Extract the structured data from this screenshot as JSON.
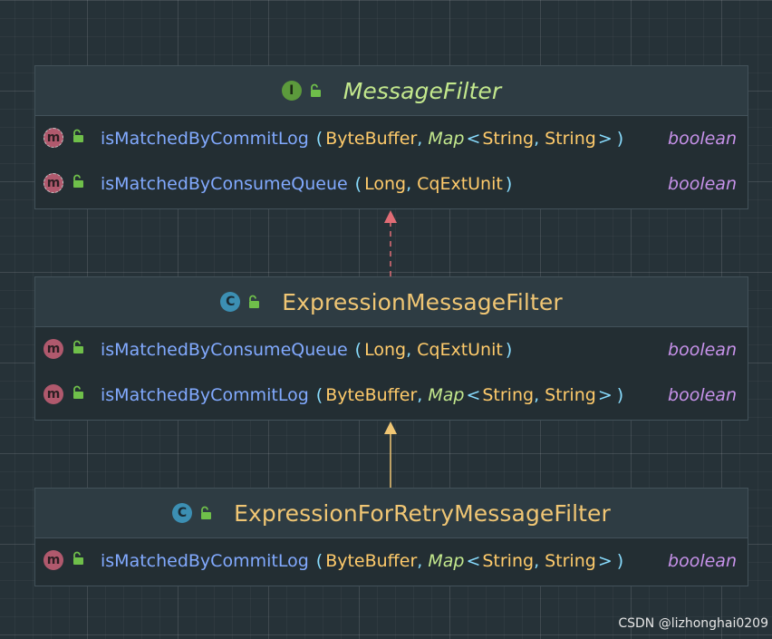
{
  "classes": [
    {
      "kind": "interface",
      "kind_letter": "I",
      "name": "MessageFilter",
      "methods": [
        {
          "name": "isMatchedByCommitLog",
          "abstract": true,
          "params": [
            "ByteBuffer",
            "Map<String, String>"
          ],
          "p1": "ByteBuffer",
          "map": "Map",
          "k": "String",
          "v": "String",
          "return": "boolean"
        },
        {
          "name": "isMatchedByConsumeQueue",
          "abstract": true,
          "params": [
            "Long",
            "CqExtUnit"
          ],
          "p1": "Long",
          "p2": "CqExtUnit",
          "return": "boolean"
        }
      ]
    },
    {
      "kind": "class",
      "kind_letter": "C",
      "name": "ExpressionMessageFilter",
      "methods": [
        {
          "name": "isMatchedByConsumeQueue",
          "abstract": false,
          "p1": "Long",
          "p2": "CqExtUnit",
          "return": "boolean"
        },
        {
          "name": "isMatchedByCommitLog",
          "abstract": false,
          "p1": "ByteBuffer",
          "map": "Map",
          "k": "String",
          "v": "String",
          "return": "boolean"
        }
      ]
    },
    {
      "kind": "class",
      "kind_letter": "C",
      "name": "ExpressionForRetryMessageFilter",
      "methods": [
        {
          "name": "isMatchedByCommitLog",
          "abstract": false,
          "p1": "ByteBuffer",
          "map": "Map",
          "k": "String",
          "v": "String",
          "return": "boolean"
        }
      ]
    }
  ],
  "method_badge_letter": "m",
  "punct": {
    "open": "(",
    "close": ")",
    "comma": ",",
    "lt": "<",
    "gt": ">"
  },
  "relations": [
    {
      "from": "ExpressionMessageFilter",
      "to": "MessageFilter",
      "type": "realization",
      "color": "#e06c75"
    },
    {
      "from": "ExpressionForRetryMessageFilter",
      "to": "ExpressionMessageFilter",
      "type": "generalization",
      "color": "#f0c674"
    }
  ],
  "watermark": "CSDN @lizhonghai0209",
  "colors": {
    "background": "#263238",
    "interface_title": "#c3e88d",
    "class_title": "#f0c674",
    "method_name": "#82aaff",
    "param_type": "#ffcb6b",
    "return_type": "#c792ea"
  }
}
